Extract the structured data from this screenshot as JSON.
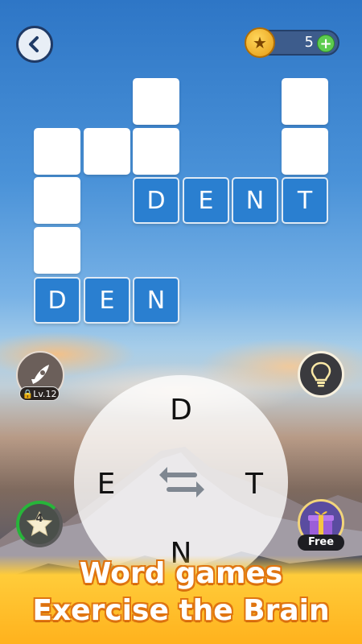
{
  "header": {
    "coins": "5",
    "plus_label": "+"
  },
  "grid": {
    "word_dent": [
      "D",
      "E",
      "N",
      "T"
    ],
    "word_den": [
      "D",
      "E",
      "N"
    ]
  },
  "side": {
    "level_lock_label": "Lv.12",
    "star_count": "4",
    "free_label": "Free"
  },
  "wheel": {
    "letters": [
      "D",
      "E",
      "T",
      "N"
    ]
  },
  "banner": {
    "line1": "Word games",
    "line2": "Exercise the Brain"
  },
  "colors": {
    "tile_blue": "#2a7fd0",
    "coin_gold": "#ffc63a",
    "banner_orange": "#ffb21d",
    "progress_green": "#27b53a"
  },
  "icons": [
    "back-arrow-icon",
    "coin-star-icon",
    "plus-icon",
    "rocket-icon",
    "lock-icon",
    "lightbulb-icon",
    "star-icon",
    "gift-icon",
    "shuffle-icon"
  ]
}
